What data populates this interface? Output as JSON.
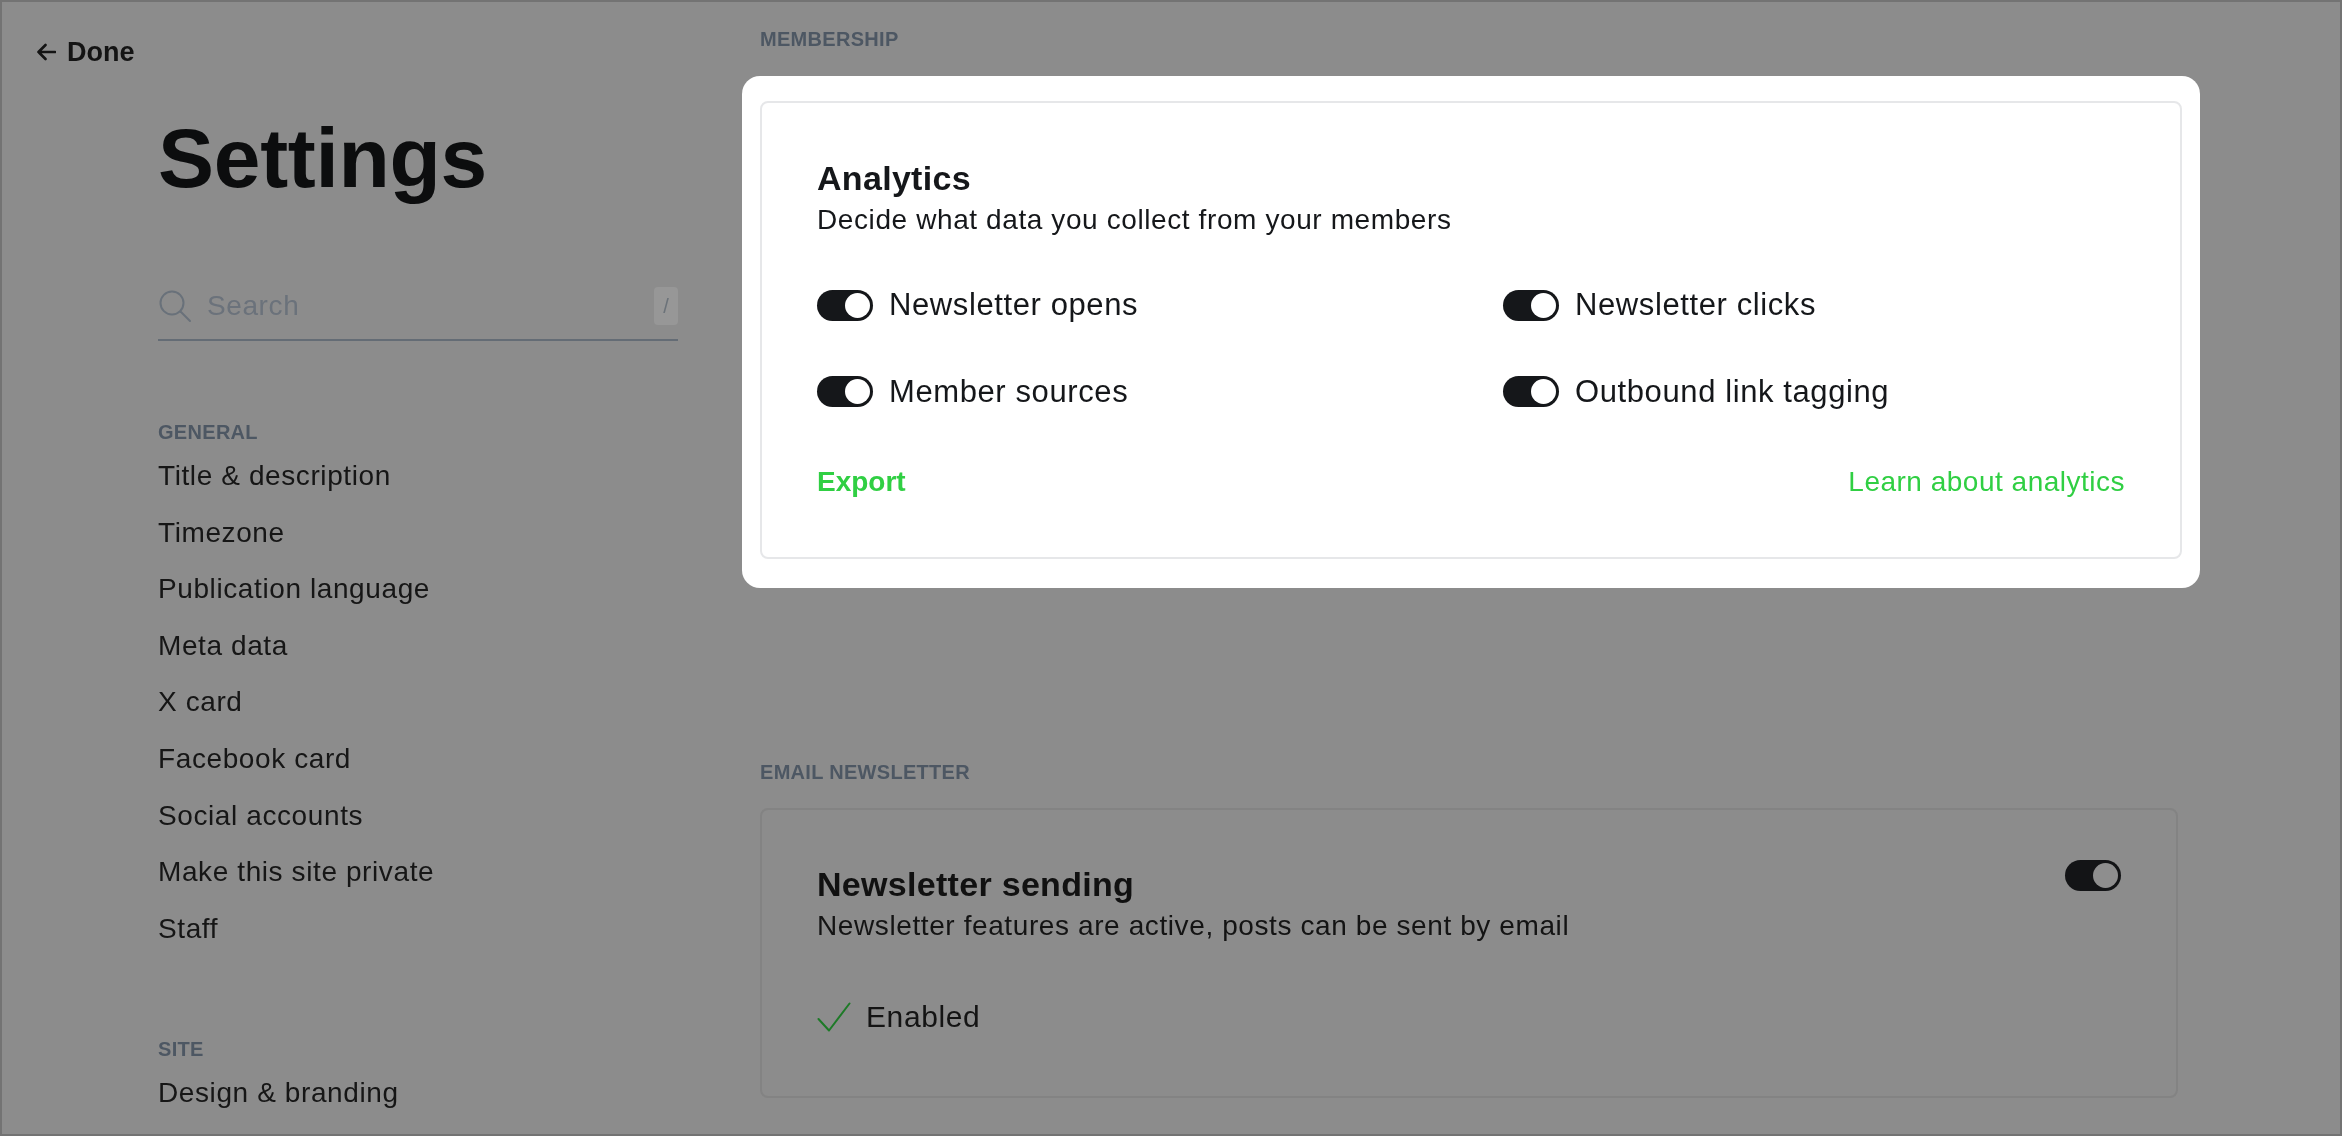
{
  "back_button": {
    "label": "Done"
  },
  "page_title": "Settings",
  "search": {
    "placeholder": "Search",
    "shortcut": "/"
  },
  "sidebar": {
    "sections": [
      {
        "heading": "GENERAL",
        "items": [
          {
            "label": "Title & description",
            "selected": false
          },
          {
            "label": "Timezone",
            "selected": false
          },
          {
            "label": "Publication language",
            "selected": false
          },
          {
            "label": "Meta data",
            "selected": false
          },
          {
            "label": "X card",
            "selected": false
          },
          {
            "label": "Facebook card",
            "selected": false
          },
          {
            "label": "Social accounts",
            "selected": false
          },
          {
            "label": "Make this site private",
            "selected": false
          },
          {
            "label": "Staff",
            "selected": false
          }
        ]
      },
      {
        "heading": "SITE",
        "items": [
          {
            "label": "Design & branding",
            "selected": false
          }
        ]
      }
    ]
  },
  "content": {
    "sections": [
      {
        "heading": "MEMBERSHIP"
      },
      {
        "heading": "EMAIL NEWSLETTER",
        "card": {
          "title": "Newsletter sending",
          "description": "Newsletter features are active, posts can be sent by email",
          "on": true,
          "status": "Enabled"
        }
      }
    ]
  },
  "dialog": {
    "title": "Analytics",
    "description": "Decide what data you collect from your members",
    "options": [
      {
        "label": "Newsletter opens",
        "on": true
      },
      {
        "label": "Newsletter clicks",
        "on": true
      },
      {
        "label": "Member sources",
        "on": true
      },
      {
        "label": "Outbound link tagging",
        "on": true
      }
    ],
    "export_button": "Export",
    "help_link": "Learn about analytics"
  }
}
